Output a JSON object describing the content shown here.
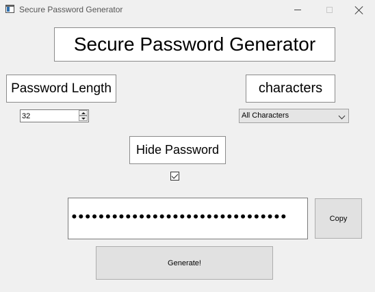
{
  "window": {
    "title": "Secure Password Generator"
  },
  "heading": "Secure Password Generator",
  "length": {
    "label": "Password Length",
    "value": "32"
  },
  "characters": {
    "label": "characters",
    "selected": "All Characters"
  },
  "hide": {
    "label": "Hide Password",
    "checked": true
  },
  "password": {
    "masked": "••••••••••••••••••••••••••••••••"
  },
  "buttons": {
    "copy": "Copy",
    "generate": "Generate!"
  }
}
